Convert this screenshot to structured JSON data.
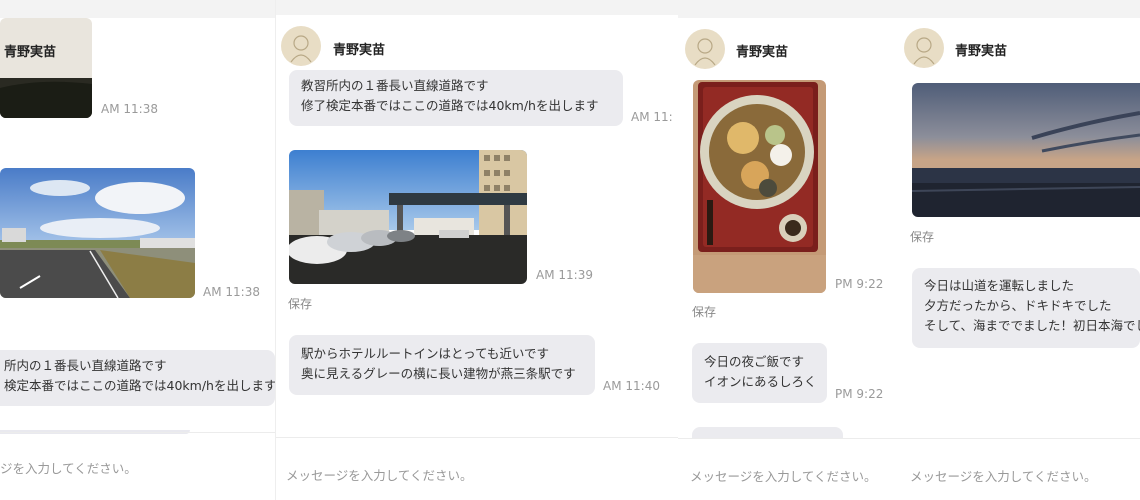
{
  "contact": {
    "name": "青野実苗"
  },
  "panel1": {
    "time_a": "AM 11:38",
    "time_b": "AM 11:38",
    "message": [
      "所内の１番長い直線道路です",
      "検定本番ではここの道路では40km/hを出します"
    ],
    "input_placeholder": "ジを入力してください。"
  },
  "panel2": {
    "message1": [
      "教習所内の１番長い直線道路です",
      "修了検定本番ではここの道路では40km/hを出します"
    ],
    "time1": "AM 11:",
    "time2": "AM 11:39",
    "save_label": "保存",
    "message2": [
      "駅からホテルルートインはとっても近いです",
      "奥に見えるグレーの横に長い建物が燕三条駅です"
    ],
    "time3": "AM 11:40",
    "input_placeholder": "メッセージを入力してください。"
  },
  "panel3": {
    "time1": "PM 9:22",
    "save_label": "保存",
    "message": [
      "今日の夜ご飯です",
      "イオンにあるしろく"
    ],
    "time2": "PM 9:22",
    "input_placeholder": "メッセージを入力してください。"
  },
  "panel4": {
    "save_label": "保存",
    "message": [
      "今日は山道を運転しました",
      "夕方だったから、ドキドキでした",
      "そして、海まででました！初日本海でし"
    ],
    "input_placeholder": "メッセージを入力してください。"
  },
  "colors": {
    "bubble": "#ebebef",
    "timestamp": "#9a9a9a",
    "avatar_bg": "#e8ddc5"
  }
}
